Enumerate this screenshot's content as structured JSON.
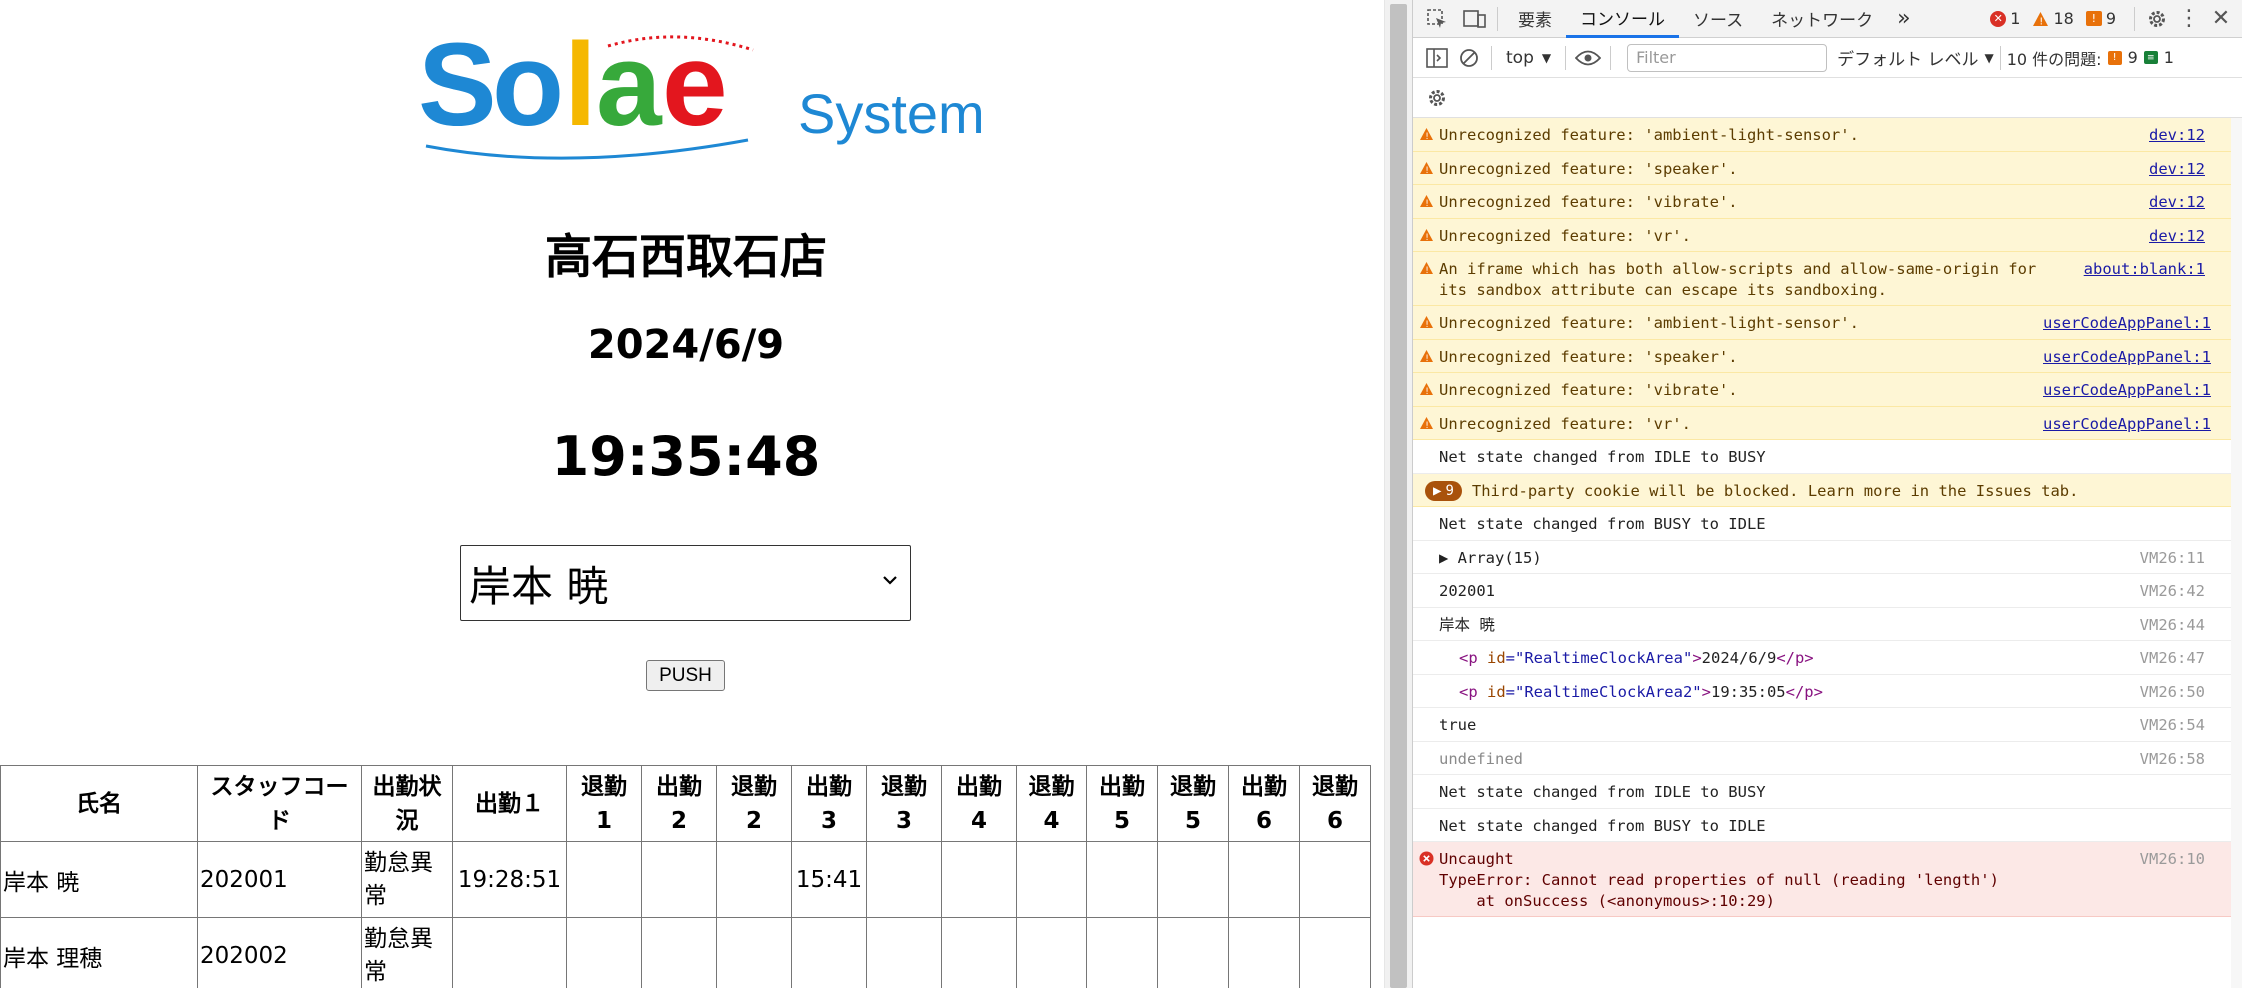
{
  "app": {
    "logo": {
      "word": "Solae",
      "sub": "System"
    },
    "shop_name": "高石西取石店",
    "date": "2024/6/9",
    "clock": "19:35:48",
    "staff_select": {
      "selected": "岸本 暁"
    },
    "push_label": "PUSH",
    "table": {
      "headers": [
        "氏名",
        "スタッフコード",
        "出勤状況",
        "出勤１",
        "退勤 1",
        "出勤 2",
        "退勤 2",
        "出勤 3",
        "退勤 3",
        "出勤 4",
        "退勤 4",
        "出勤 5",
        "退勤 5",
        "出勤 6",
        "退勤 6"
      ],
      "header_lines": [
        [
          "氏名"
        ],
        [
          "スタッフコー",
          "ド"
        ],
        [
          "出勤状",
          "況"
        ],
        [
          "出勤１"
        ],
        [
          "退勤",
          "1"
        ],
        [
          "出勤",
          "2"
        ],
        [
          "退勤",
          "2"
        ],
        [
          "出勤",
          "3"
        ],
        [
          "退勤",
          "3"
        ],
        [
          "出勤",
          "4"
        ],
        [
          "退勤",
          "4"
        ],
        [
          "出勤",
          "5"
        ],
        [
          "退勤",
          "5"
        ],
        [
          "出勤",
          "6"
        ],
        [
          "退勤",
          "6"
        ]
      ],
      "rows": [
        {
          "name": "岸本 暁",
          "code": "202001",
          "status": "勤怠異常",
          "status_lines": [
            "勤怠異",
            "常"
          ],
          "times": [
            "19:28:51",
            "",
            "",
            "",
            "15:41",
            "",
            "",
            "",
            "",
            "",
            "",
            ""
          ]
        },
        {
          "name": "岸本 理穂",
          "code": "202002",
          "status": "勤怠異常",
          "status_lines": [
            "勤怠異",
            "常"
          ],
          "times": [
            "",
            "",
            "",
            "",
            "",
            "",
            "",
            "",
            "",
            "",
            "",
            ""
          ]
        }
      ]
    }
  },
  "devtools": {
    "tabs": [
      "要素",
      "コンソール",
      "ソース",
      "ネットワーク"
    ],
    "active_tab": "コンソール",
    "more_tabs": "»",
    "counts": {
      "errors": "1",
      "warnings": "18",
      "issues": "9"
    },
    "context": "top",
    "filter_placeholder": "Filter",
    "level": "デフォルト レベル",
    "issues_label": "10 件の問題:",
    "issues_counts": {
      "warn": "9",
      "info": "1"
    },
    "colors": {
      "accent": "#1a73e8",
      "warn_bg": "#fef6d5",
      "error_bg": "#fce8e6",
      "error": "#d93025",
      "warn": "#e8710a"
    },
    "messages": [
      {
        "level": "warn",
        "text": "Unrecognized feature: 'ambient-light-sensor'.",
        "source": "dev:12"
      },
      {
        "level": "warn",
        "text": "Unrecognized feature: 'speaker'.",
        "source": "dev:12"
      },
      {
        "level": "warn",
        "text": "Unrecognized feature: 'vibrate'.",
        "source": "dev:12"
      },
      {
        "level": "warn",
        "text": "Unrecognized feature: 'vr'.",
        "source": "dev:12"
      },
      {
        "level": "warn",
        "text": "An iframe which has both allow-scripts and allow-same-origin for its sandbox attribute can escape its sandboxing.",
        "source": "about:blank:1"
      },
      {
        "level": "warn",
        "text": "Unrecognized feature: 'ambient-light-sensor'.",
        "source": "userCodeAppPanel:1"
      },
      {
        "level": "warn",
        "text": "Unrecognized feature: 'speaker'.",
        "source": "userCodeAppPanel:1"
      },
      {
        "level": "warn",
        "text": "Unrecognized feature: 'vibrate'.",
        "source": "userCodeAppPanel:1"
      },
      {
        "level": "warn",
        "text": "Unrecognized feature: 'vr'.",
        "source": "userCodeAppPanel:1"
      },
      {
        "level": "info",
        "text": "Net state changed from IDLE to BUSY",
        "source": ""
      },
      {
        "level": "group",
        "count": "9",
        "text": "Third-party cookie will be blocked. Learn more in the Issues tab.",
        "source": ""
      },
      {
        "level": "info",
        "text": "Net state changed from BUSY to IDLE",
        "source": ""
      },
      {
        "level": "info",
        "text": "▶ Array(15)",
        "source": "VM26:11"
      },
      {
        "level": "info",
        "text": "202001",
        "source": "VM26:42"
      },
      {
        "level": "info",
        "text": "岸本 暁",
        "source": "VM26:44"
      },
      {
        "level": "html",
        "id": "RealtimeClockArea",
        "inner": "2024/6/9",
        "source": "VM26:47"
      },
      {
        "level": "html",
        "id": "RealtimeClockArea2",
        "inner": "19:35:05",
        "source": "VM26:50"
      },
      {
        "level": "info",
        "text": "true",
        "source": "VM26:54"
      },
      {
        "level": "dim",
        "text": "undefined",
        "source": "VM26:58"
      },
      {
        "level": "info",
        "text": "Net state changed from IDLE to BUSY",
        "source": ""
      },
      {
        "level": "info",
        "text": "Net state changed from BUSY to IDLE",
        "source": ""
      },
      {
        "level": "error",
        "text": "Uncaught\nTypeError: Cannot read properties of null (reading 'length')\n    at onSuccess (<anonymous>:10:29)",
        "source": "VM26:10"
      }
    ]
  }
}
